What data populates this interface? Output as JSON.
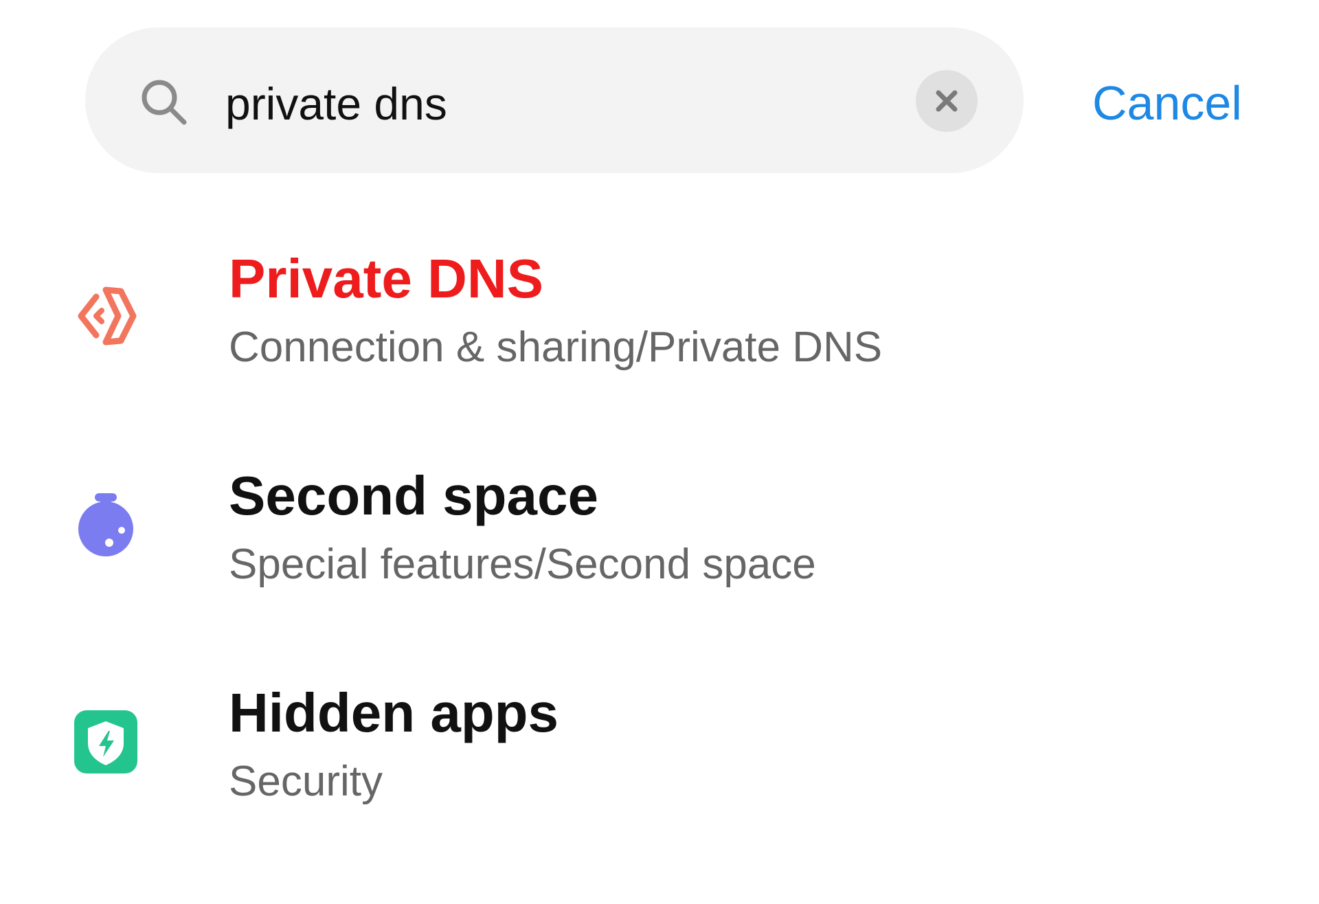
{
  "search": {
    "query": "private dns",
    "cancel_label": "Cancel",
    "search_icon": "search-icon",
    "clear_icon": "close-icon"
  },
  "results": [
    {
      "title": "Private DNS",
      "subtitle": "Connection & sharing/Private DNS",
      "icon": "private-dns-icon",
      "title_color": "#ee1c1c",
      "icon_color": "#f2765e"
    },
    {
      "title": "Second space",
      "subtitle": "Special features/Second space",
      "icon": "second-space-icon",
      "icon_color": "#7b7cf0"
    },
    {
      "title": "Hidden apps",
      "subtitle": "Security",
      "icon": "security-shield-icon",
      "icon_color": "#23c48e"
    }
  ],
  "colors": {
    "accent": "#1e88e5",
    "search_bg": "#f3f3f3",
    "clear_bg": "#e0e0e0",
    "subtitle": "#666666"
  }
}
